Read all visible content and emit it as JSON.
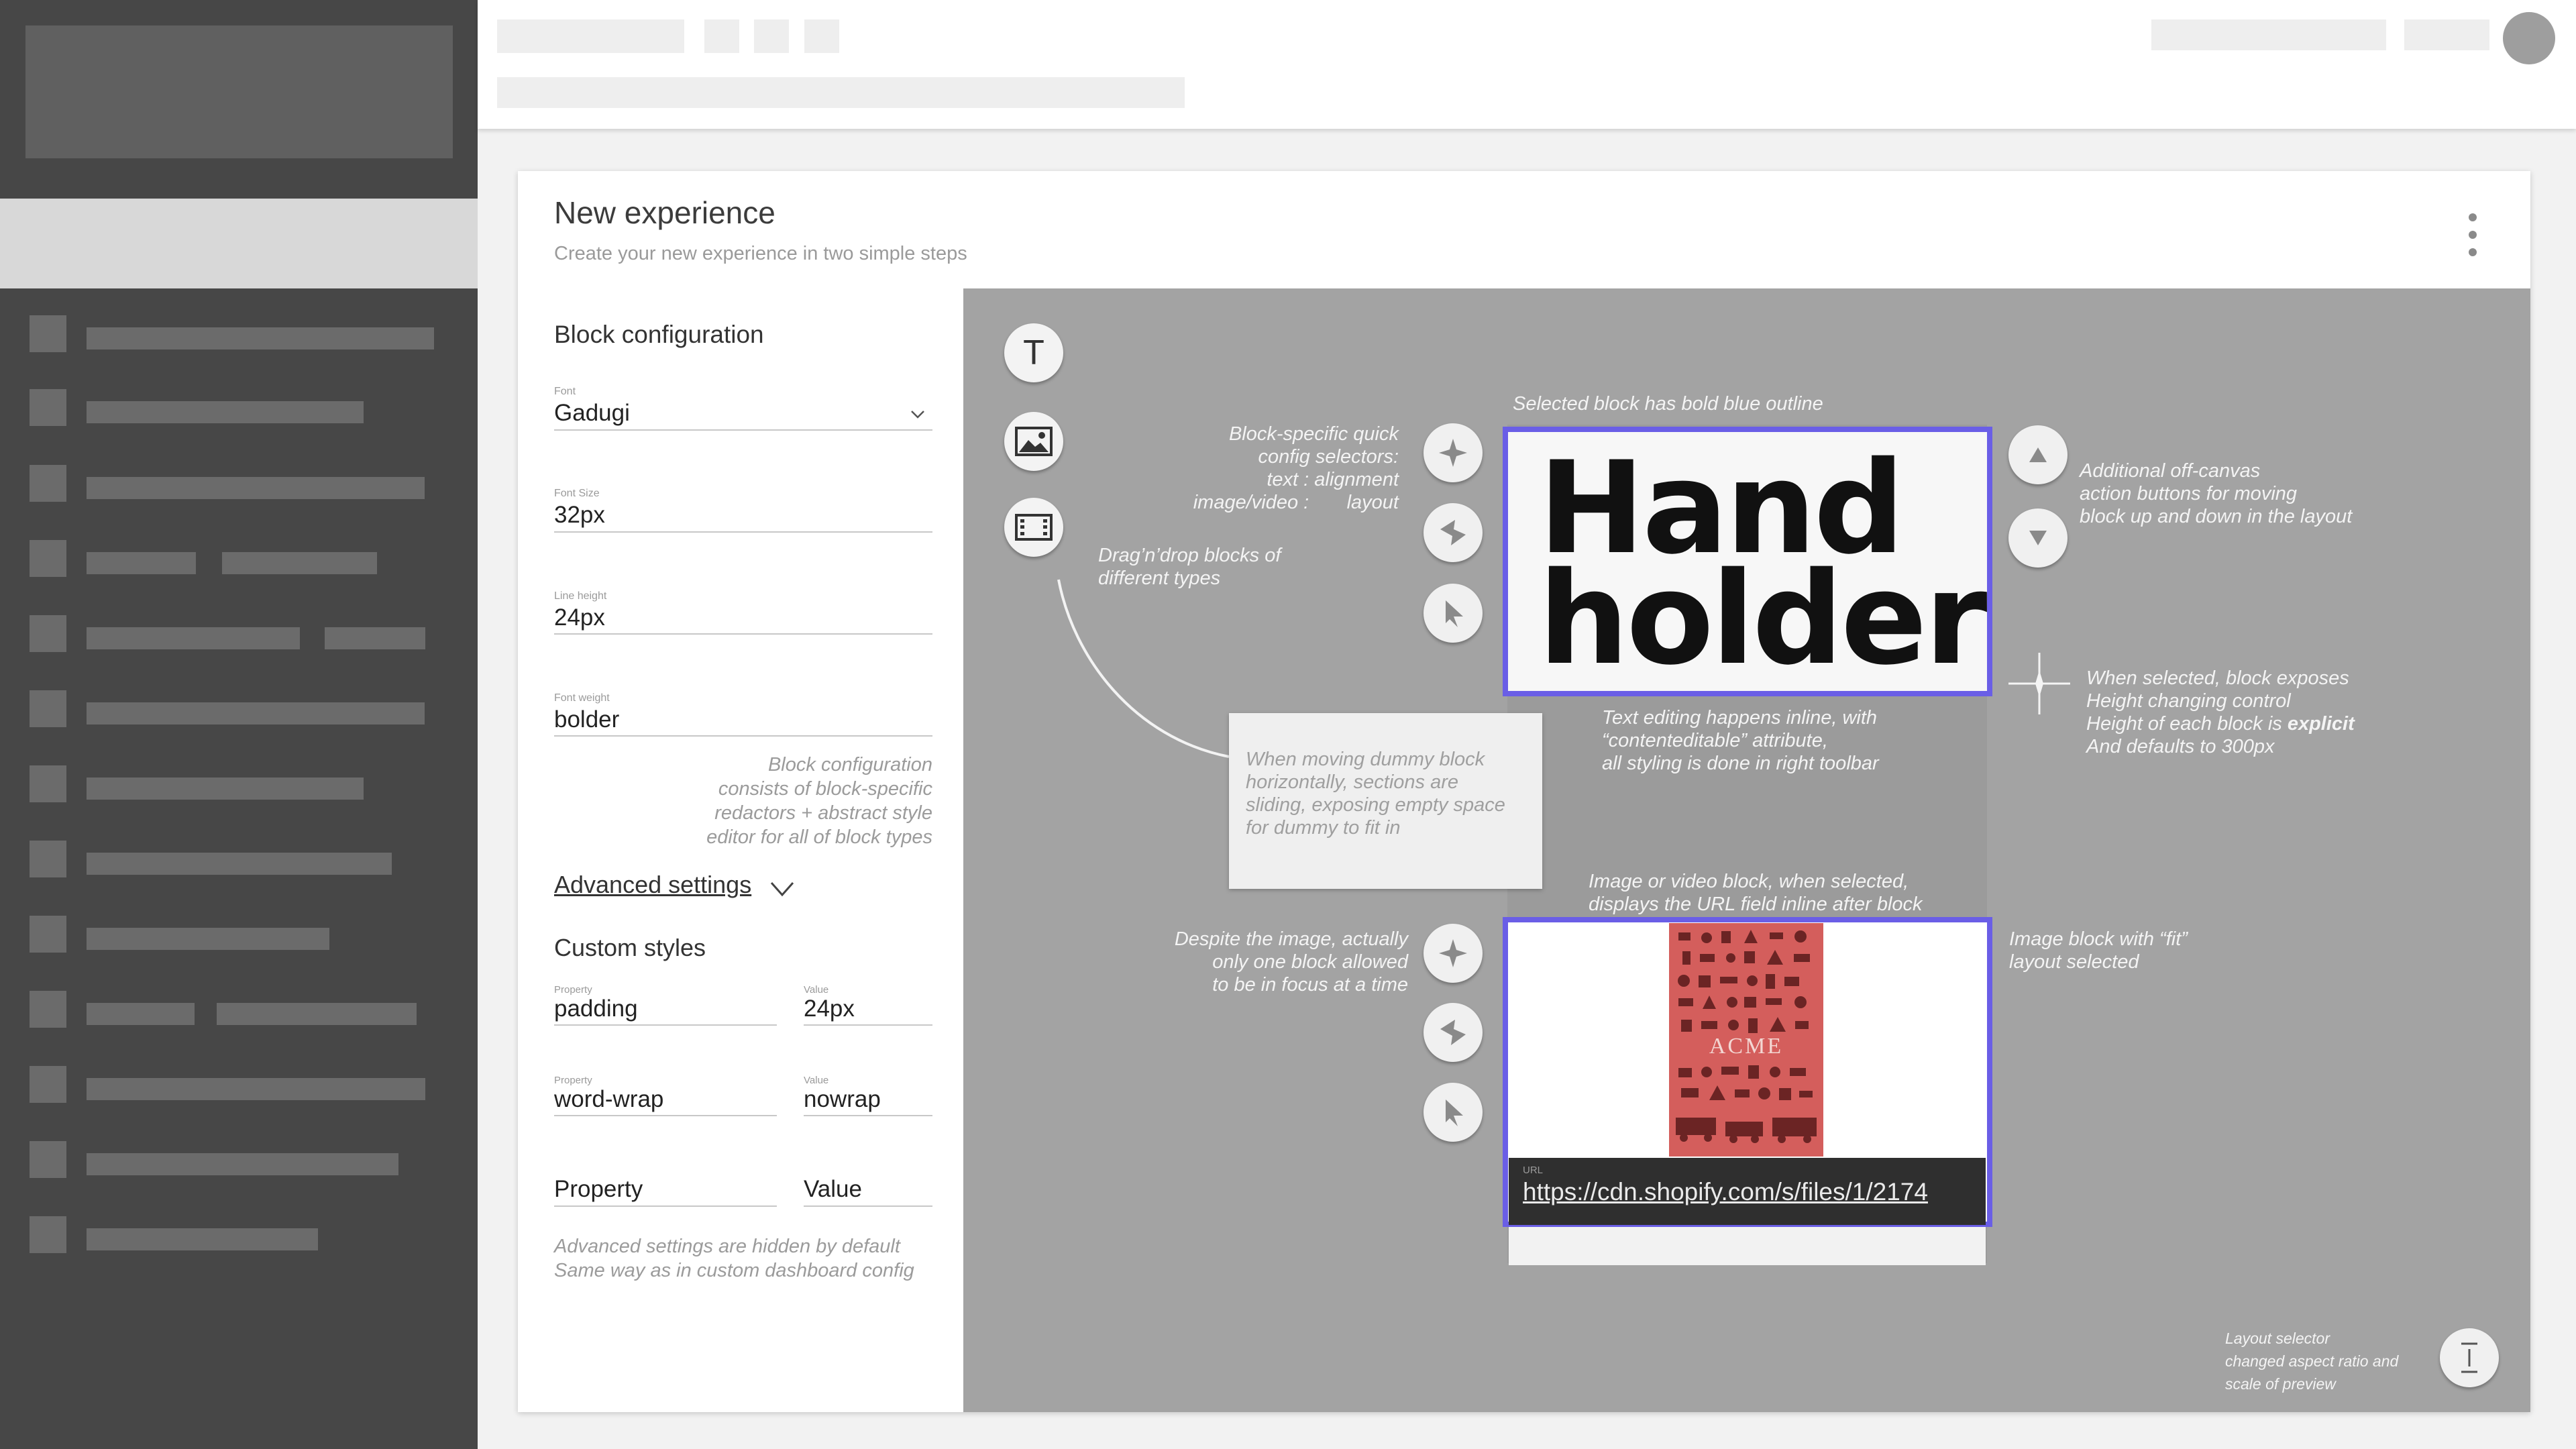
{
  "colors": {
    "selection_outline": "#6a5ee6",
    "sidebar_bg": "#474747",
    "preview_bg": "#a3a3a3",
    "poster_red": "#d45e5c"
  },
  "card": {
    "title": "New experience",
    "subtitle": "Create your new experience in two simple steps",
    "menu_icon": "kebab-menu-icon"
  },
  "config": {
    "heading": "Block configuration",
    "fields": [
      {
        "label": "Font",
        "value": "Gadugi"
      },
      {
        "label": "Font Size",
        "value": "32px"
      },
      {
        "label": "Line height",
        "value": "24px"
      },
      {
        "label": "Font weight",
        "value": "bolder"
      }
    ],
    "note": [
      "Block configuration",
      "consists of block-specific",
      "redactors + abstract style",
      "editor for all of block types"
    ],
    "advanced_label": "Advanced settings",
    "custom_styles_heading": "Custom styles",
    "custom_styles": [
      {
        "prop_label": "Property",
        "prop": "padding",
        "val_label": "Value",
        "val": "24px"
      },
      {
        "prop_label": "Property",
        "prop": "word-wrap",
        "val_label": "Value",
        "val": "nowrap"
      }
    ],
    "empty_row": {
      "prop_placeholder": "Property",
      "val_placeholder": "Value"
    },
    "advanced_note": [
      "Advanced settings are hidden by default",
      "Same way as in custom dashboard config"
    ]
  },
  "palette": {
    "text_block_glyph": "T",
    "icons": [
      "text-block-icon",
      "image-block-icon",
      "video-block-icon"
    ]
  },
  "annotations": {
    "selected_outline": "Selected block has bold blue outline",
    "quick_config": [
      "Block-specific quick",
      "config selectors:",
      "text : alignment",
      "image/video :       layout"
    ],
    "drag_drop": [
      "Drag’n’drop blocks of",
      "different types"
    ],
    "off_canvas": [
      "Additional off-canvas",
      "action buttons for moving",
      "block up and down in the layout"
    ],
    "height_pre": [
      "When selected, block exposes",
      "Height changing control"
    ],
    "height_line3_a": "Height of each block is ",
    "height_line3_b": "explicit",
    "height_line4": "And defaults to 300px",
    "inline_edit": [
      "Text editing happens inline, with",
      "“contenteditable” attribute,",
      "all styling is done in right toolbar"
    ],
    "dummy_block": [
      "When moving dummy block",
      "horizontally, sections are",
      "sliding, exposing empty space",
      "for dummy to fit in"
    ],
    "image_url": [
      "Image or video block, when selected,",
      "displays the URL field inline after block"
    ],
    "one_focus": [
      "Despite the image, actually",
      "only one block allowed",
      "to be in focus at a time"
    ],
    "fit_layout": [
      "Image block with “fit”",
      "layout selected"
    ],
    "layout_selector": [
      "Layout selector",
      "changed aspect ratio and",
      "scale of preview"
    ]
  },
  "text_block": {
    "lines": [
      "Hand",
      "holder"
    ]
  },
  "image_block": {
    "poster_text": "ACME",
    "url_label": "URL",
    "url_value": "https://cdn.shopify.com/s/files/1/2174"
  }
}
